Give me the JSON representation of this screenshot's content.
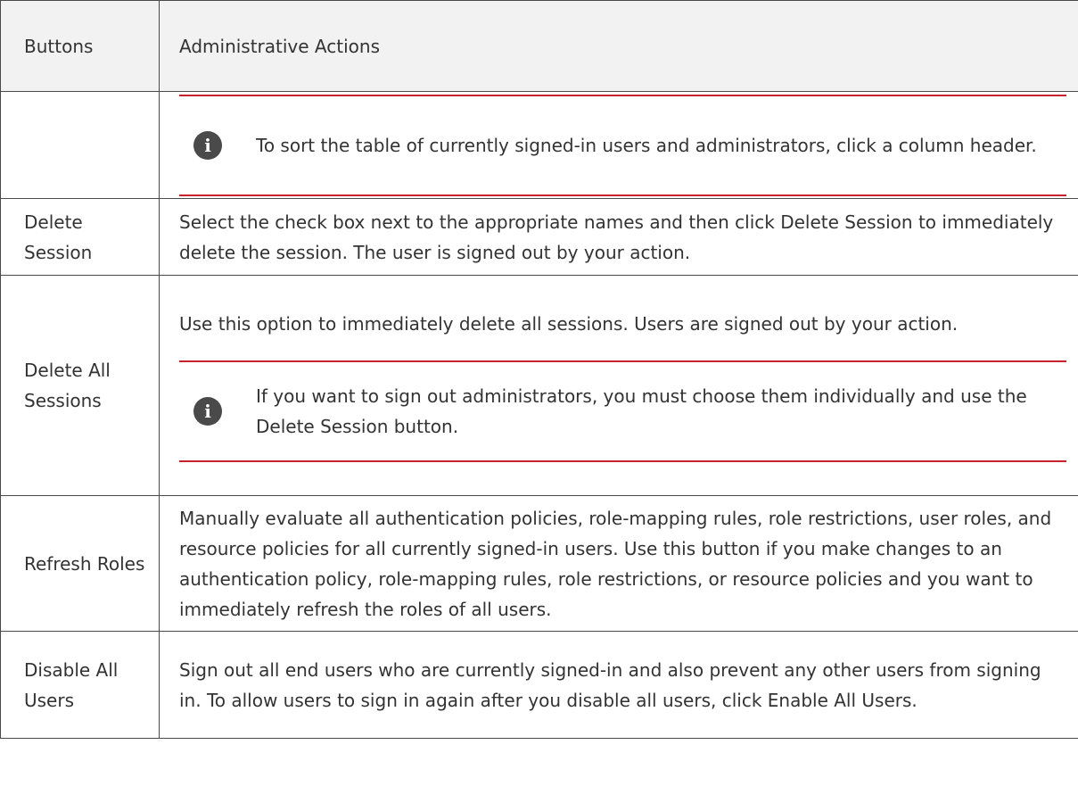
{
  "table": {
    "header": {
      "col1": "Buttons",
      "col2": "Administrative Actions"
    },
    "rows": [
      {
        "button": "",
        "note": "To sort the table of currently signed-in users and administrators, click a column header."
      },
      {
        "button": "Delete Session",
        "text": "Select the check box next to the appropriate names and then click Delete Session to immediately delete the session. The user is signed out by your action."
      },
      {
        "button": "Delete All Sessions",
        "text": "Use this option to immediately delete all sessions. Users are signed out by your action.",
        "note": "If you want to sign out administrators, you must choose them individually and use the Delete Session button."
      },
      {
        "button": "Refresh Roles",
        "text": "Manually evaluate all authentication policies, role-mapping rules, role restrictions, user roles, and resource policies for all currently signed-in users. Use this button if you make changes to an authentication policy, role-mapping rules, role restrictions, or resource policies and you want to immediately refresh the roles of all users."
      },
      {
        "button": "Disable All Users",
        "text": "Sign out all end users who are currently signed-in and also prevent any other users from signing in. To allow users to sign in again after you disable all users, click Enable All Users."
      }
    ],
    "note_icon": "info-icon",
    "colors": {
      "note_rule": "#c8232c",
      "header_bg": "#f2f2f2",
      "icon_bg": "#4a4a4a",
      "border": "#4a4a4a"
    }
  }
}
